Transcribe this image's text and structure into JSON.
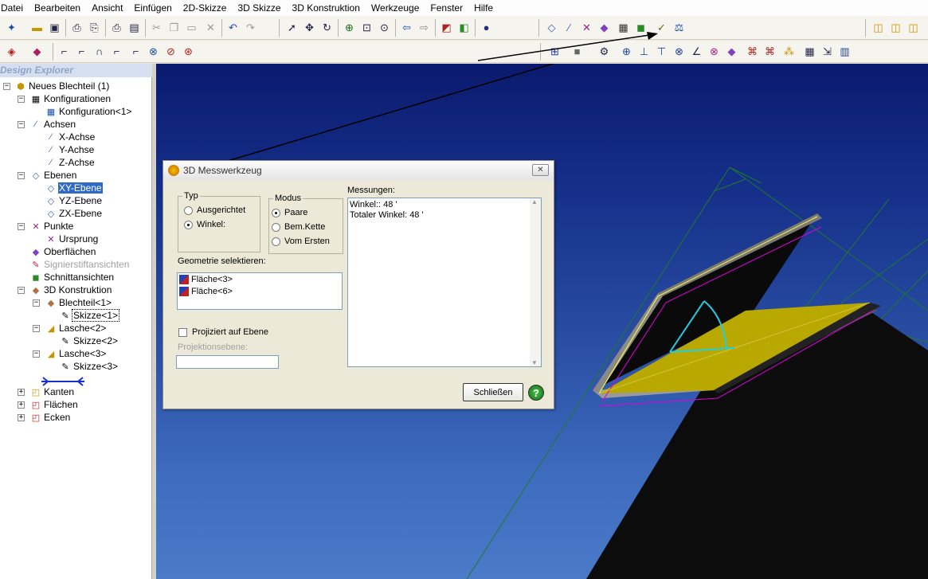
{
  "menu": [
    "Datei",
    "Bearbeiten",
    "Ansicht",
    "Einfügen",
    "2D-Skizze",
    "3D Skizze",
    "3D Konstruktion",
    "Werkzeuge",
    "Fenster",
    "Hilfe"
  ],
  "explorer": {
    "title": "Design Explorer",
    "nodes": {
      "root": "Neues Blechteil (1)",
      "konfigurationen": "Konfigurationen",
      "konfiguration1": "Konfiguration<1>",
      "achsen": "Achsen",
      "x_achse": "X-Achse",
      "y_achse": "Y-Achse",
      "z_achse": "Z-Achse",
      "ebenen": "Ebenen",
      "xy_ebene": "XY-Ebene",
      "yz_ebene": "YZ-Ebene",
      "zx_ebene": "ZX-Ebene",
      "punkte": "Punkte",
      "ursprung": "Ursprung",
      "oberflaechen": "Oberflächen",
      "signierstift": "Signierstiftansichten",
      "schnittansichten": "Schnittansichten",
      "konstruktion": "3D Konstruktion",
      "blechteil1": "Blechteil<1>",
      "skizze1": "Skizze<1>",
      "lasche2": "Lasche<2>",
      "skizze2": "Skizze<2>",
      "lasche3": "Lasche<3>",
      "skizze3": "Skizze<3>",
      "kanten": "Kanten",
      "flaechen": "Flächen",
      "ecken": "Ecken"
    }
  },
  "dialog": {
    "title": "3D Messwerkzeug",
    "typ_label": "Typ",
    "typ_options": [
      "Ausgerichtet",
      "Winkel:"
    ],
    "typ_selected": "Winkel:",
    "modus_label": "Modus",
    "modus_options": [
      "Paare",
      "Bem.Kette",
      "Vom Ersten"
    ],
    "modus_selected": "Paare",
    "messungen_label": "Messungen:",
    "messungen": [
      "Winkel:: 48 '",
      "Totaler Winkel: 48 '"
    ],
    "geometrie_label": "Geometrie selektieren:",
    "geometrie": [
      "Fläche<3>",
      "Fläche<6>"
    ],
    "projiziert_label": "Projiziert auf Ebene",
    "projektionsebene_label": "Projektionsebene:",
    "projektionsebene_value": "",
    "close_label": "Schließen",
    "help_glyph": "?"
  },
  "colors": {
    "accent_selection": "#316ac5",
    "viewport_top": "#0a1a6e",
    "viewport_bottom": "#4a7ac8",
    "part_face": "#b8a800",
    "angle_marker": "#20d0e0",
    "edge_highlight": "#e000e0",
    "wireframe": "#1f7a2c"
  },
  "icons": [
    "new-icon",
    "open-icon",
    "save-icon",
    "print-icon",
    "cut-icon",
    "copy-icon",
    "paste-icon",
    "undo-icon",
    "redo-icon",
    "select-icon",
    "zoom-icon",
    "measure-tool-icon",
    "help-icon"
  ]
}
